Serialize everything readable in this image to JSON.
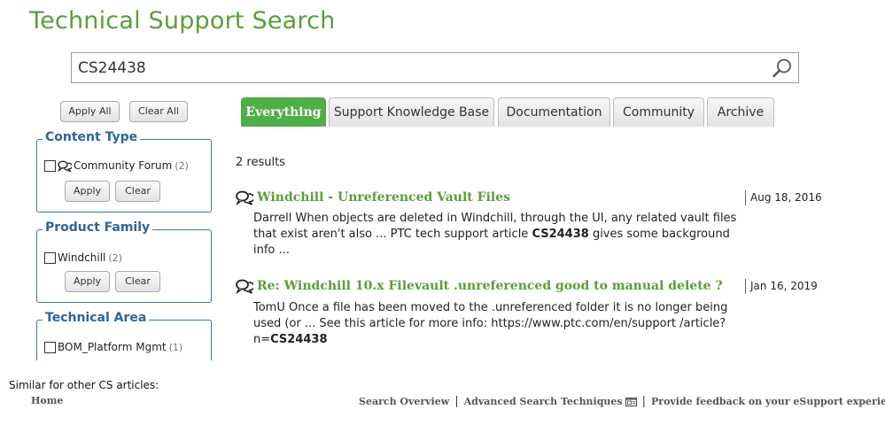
{
  "page_title": "Technical Support Search",
  "search": {
    "value": "CS24438",
    "placeholder": ""
  },
  "global_actions": {
    "apply_all": "Apply All",
    "clear_all": "Clear All"
  },
  "facets": [
    {
      "title": "Content Type",
      "items": [
        {
          "label": "Community Forum",
          "count": "(2)",
          "icon": "forum-icon"
        }
      ],
      "apply": "Apply",
      "clear": "Clear"
    },
    {
      "title": "Product Family",
      "items": [
        {
          "label": "Windchill",
          "count": "(2)"
        }
      ],
      "apply": "Apply",
      "clear": "Clear"
    },
    {
      "title": "Technical Area",
      "items": [
        {
          "label": "BOM_Platform Mgmt",
          "count": "(1)"
        }
      ]
    }
  ],
  "tabs": [
    {
      "label": "Everything",
      "active": true
    },
    {
      "label": "Support Knowledge Base",
      "active": false
    },
    {
      "label": "Documentation",
      "active": false
    },
    {
      "label": "Community",
      "active": false
    },
    {
      "label": "Archive",
      "active": false
    }
  ],
  "results_count": "2 results",
  "results": [
    {
      "title": "Windchill - Unreferenced Vault Files",
      "date": "Aug 18, 2016",
      "icon": "forum-icon",
      "snippet_pre": "Darrell When objects are deleted in Windchill, through the UI, any related vault files that exist aren't also ... PTC tech support article ",
      "snippet_bold": "CS24438",
      "snippet_post": " gives some background info ..."
    },
    {
      "title": "Re: Windchill 10.x Filevault .unreferenced good to manual delete ?",
      "date": "Jan 16, 2019",
      "icon": "forum-icon",
      "snippet_pre": "TomU Once a file has been moved to the .unreferenced folder it is no longer being used (or ... See this article for more info: https://www.ptc.com/en/support /article?n=",
      "snippet_bold": "CS24438",
      "snippet_post": ""
    }
  ],
  "footnote": "Similar for other CS articles:",
  "footer": {
    "home": "Home",
    "links": [
      "Search Overview",
      "Advanced Search Techniques",
      "Provide feedback on your eSupport experience"
    ],
    "separator": "|"
  },
  "colors": {
    "accent_green": "#4fae48",
    "title_green": "#5a9e3a",
    "facet_blue": "#2f6596"
  }
}
